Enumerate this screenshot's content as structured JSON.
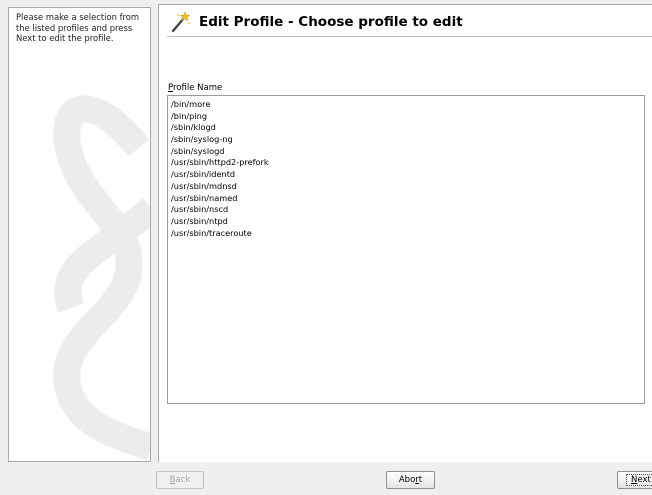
{
  "help": {
    "text": "Please make a selection from the listed profiles and press Next to edit the profile."
  },
  "header": {
    "title": "Edit Profile - Choose profile to edit",
    "icon": "magic-wand-icon"
  },
  "profile_list": {
    "label_mnemonic": "P",
    "label_rest": "rofile Name",
    "items": [
      "/bin/more",
      "/bin/ping",
      "/sbin/klogd",
      "/sbin/syslog-ng",
      "/sbin/syslogd",
      "/usr/sbin/httpd2-prefork",
      "/usr/sbin/identd",
      "/usr/sbin/mdnsd",
      "/usr/sbin/named",
      "/usr/sbin/nscd",
      "/usr/sbin/ntpd",
      "/usr/sbin/traceroute"
    ]
  },
  "buttons": {
    "back": {
      "mnemonic": "B",
      "rest": "ack",
      "enabled": false
    },
    "abort": {
      "before": "Abo",
      "mnemonic": "r",
      "after": "t",
      "enabled": true
    },
    "next": {
      "mnemonic": "N",
      "rest": "ext",
      "enabled": true
    }
  },
  "colors": {
    "window_bg": "#efefef",
    "panel_bg": "#ffffff",
    "watermark": "#ececec"
  }
}
